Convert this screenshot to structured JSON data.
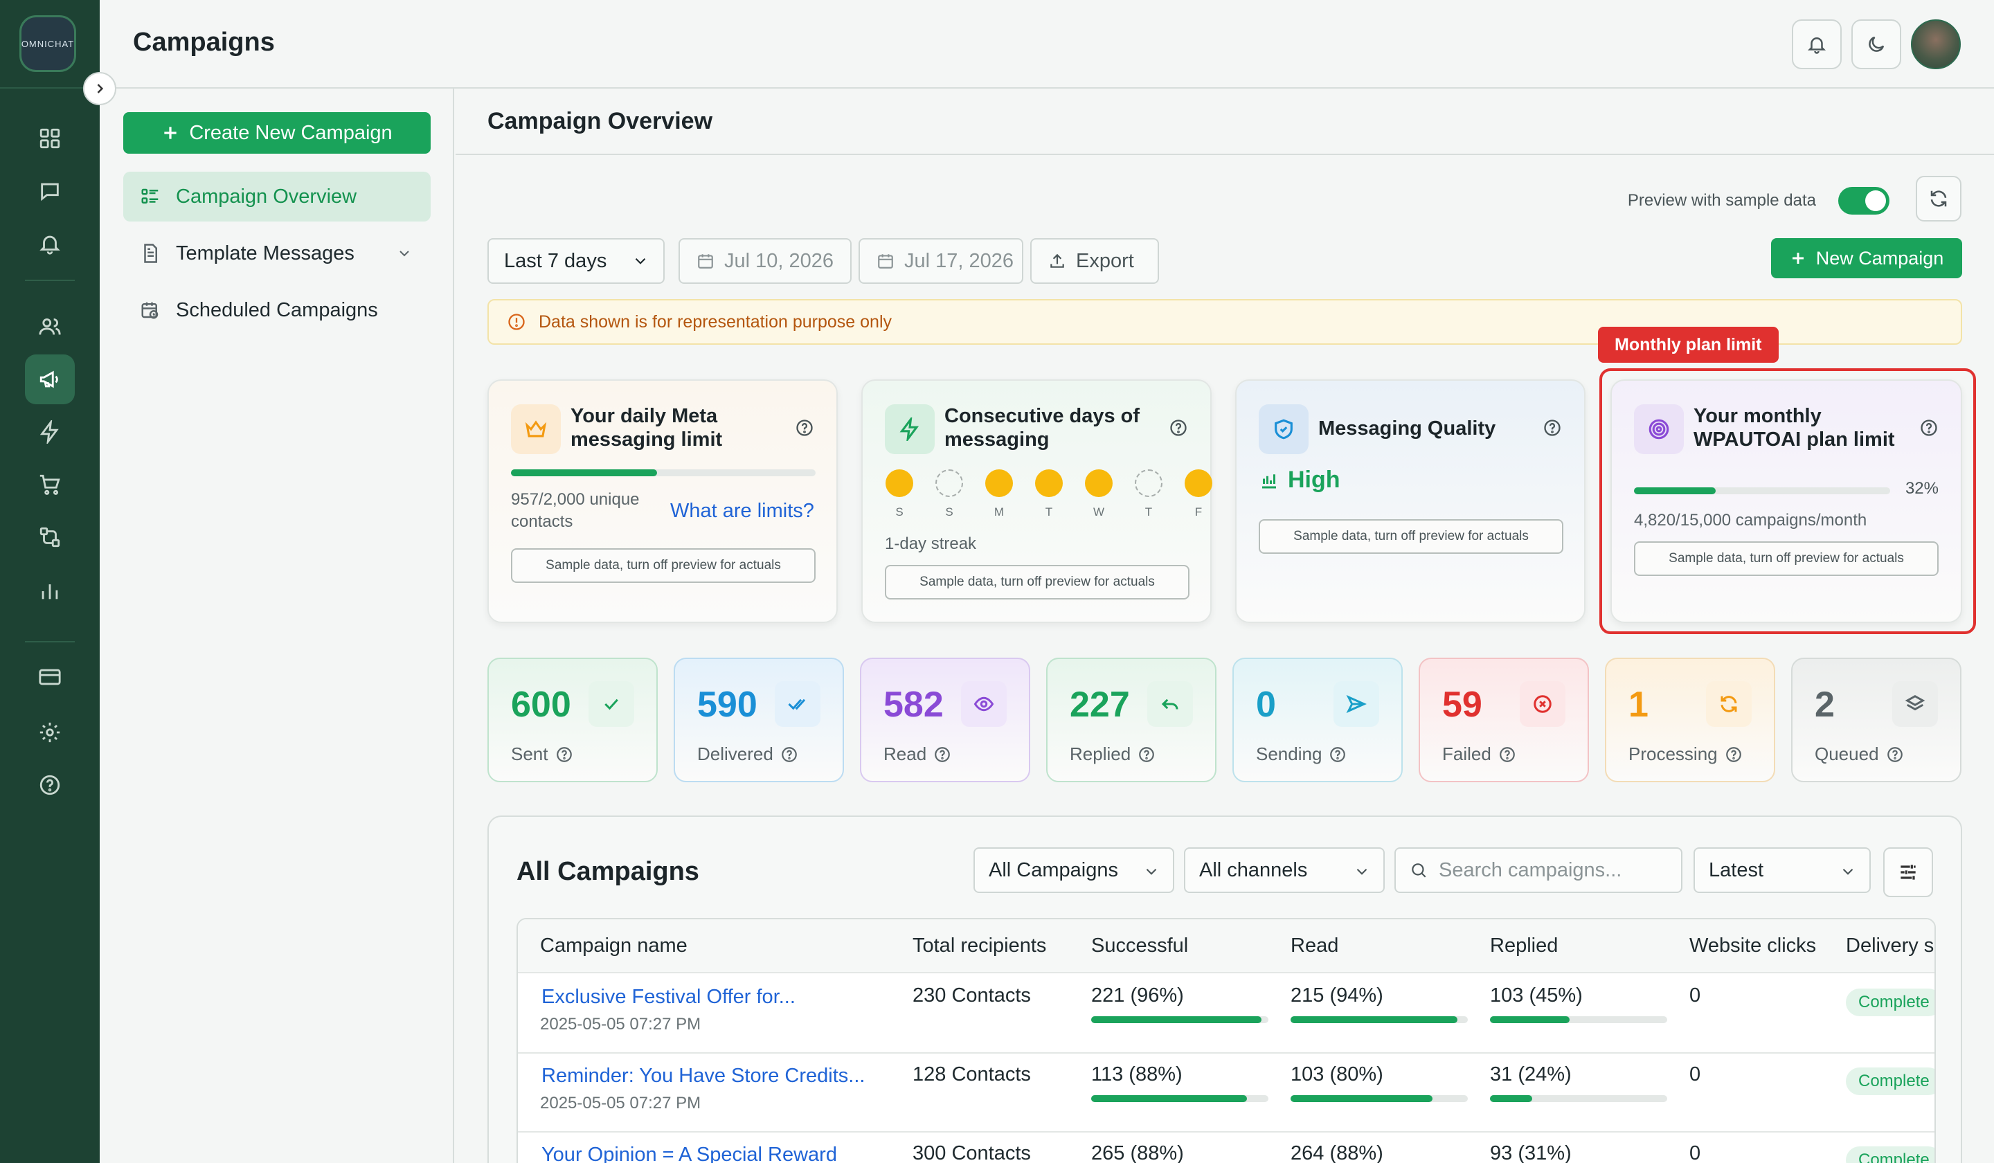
{
  "rail": {
    "logo_text": "OMNICHAT",
    "items": [
      {
        "name": "dashboard-icon"
      },
      {
        "name": "chat-icon"
      },
      {
        "name": "bell-icon"
      },
      {
        "name": "users-icon"
      },
      {
        "name": "megaphone-icon",
        "active": true
      },
      {
        "name": "bolt-icon"
      },
      {
        "name": "cart-icon"
      },
      {
        "name": "flow-icon"
      },
      {
        "name": "bar-chart-icon"
      },
      {
        "name": "card-icon"
      },
      {
        "name": "settings-icon"
      },
      {
        "name": "help-icon"
      }
    ]
  },
  "header": {
    "title": "Campaigns"
  },
  "subnav": {
    "create_label": "Create New Campaign",
    "items": [
      {
        "label": "Campaign Overview",
        "active": true
      },
      {
        "label": "Template Messages"
      },
      {
        "label": "Scheduled Campaigns"
      }
    ]
  },
  "main": {
    "title": "Campaign Overview",
    "preview_label": "Preview with sample data",
    "preview_on": true,
    "range_select": "Last 7 days",
    "date_from": "Jul 10, 2026",
    "date_to": "Jul 17, 2026",
    "export_label": "Export",
    "new_campaign_label": "New Campaign",
    "notice": "Data shown is for representation purpose only"
  },
  "limit_cards": {
    "meta": {
      "title": "Your daily Meta messaging limit",
      "usage": "957/2,000 unique contacts",
      "usage_fraction": 0.4785,
      "link": "What are limits?",
      "chip": "Sample data, turn off preview for actuals"
    },
    "streak": {
      "title": "Consecutive days of messaging",
      "days": [
        {
          "d": "S",
          "on": true
        },
        {
          "d": "S",
          "on": false
        },
        {
          "d": "M",
          "on": true
        },
        {
          "d": "T",
          "on": true
        },
        {
          "d": "W",
          "on": true
        },
        {
          "d": "T",
          "on": false
        },
        {
          "d": "F",
          "on": true
        }
      ],
      "streak_text": "1-day streak",
      "chip": "Sample data, turn off preview for actuals"
    },
    "quality": {
      "title": "Messaging Quality",
      "value": "High",
      "chip": "Sample data, turn off preview for actuals"
    },
    "plan": {
      "badge": "Monthly plan limit",
      "title": "Your monthly WPAUTOAI plan limit",
      "percent": "32%",
      "percent_value": 32,
      "usage": "4,820/15,000 campaigns/month",
      "chip": "Sample data, turn off preview for actuals"
    }
  },
  "stats": [
    {
      "value": "600",
      "label": "Sent",
      "icon": "check-icon",
      "color": "#1aa35b",
      "tint": "#e7f5ec",
      "border": "#bfe3cd"
    },
    {
      "value": "590",
      "label": "Delivered",
      "icon": "double-check-icon",
      "color": "#1a8fd6",
      "tint": "#e4f1fb",
      "border": "#bcdcf2"
    },
    {
      "value": "582",
      "label": "Read",
      "icon": "eye-icon",
      "color": "#8a4ad6",
      "tint": "#efe6fa",
      "border": "#d9c9f0"
    },
    {
      "value": "227",
      "label": "Replied",
      "icon": "reply-icon",
      "color": "#1aa35b",
      "tint": "#e7f5ec",
      "border": "#bfe3cd"
    },
    {
      "value": "0",
      "label": "Sending",
      "icon": "send-icon",
      "color": "#1a9fc8",
      "tint": "#e2f4f8",
      "border": "#bde2ec"
    },
    {
      "value": "59",
      "label": "Failed",
      "icon": "x-circle-icon",
      "color": "#e0312f",
      "tint": "#fce7e8",
      "border": "#f3c3c5"
    },
    {
      "value": "1",
      "label": "Processing",
      "icon": "refresh-icon",
      "color": "#f39a12",
      "tint": "#fdf1de",
      "border": "#f3dcb6"
    },
    {
      "value": "2",
      "label": "Queued",
      "icon": "layers-icon",
      "color": "#5a6468",
      "tint": "#eceeed",
      "border": "#d6dbd9"
    }
  ],
  "campaigns": {
    "title": "All Campaigns",
    "filter_type": "All Campaigns",
    "filter_channel": "All channels",
    "search_placeholder": "Search campaigns...",
    "sort": "Latest",
    "columns": [
      "Campaign name",
      "Total recipients",
      "Successful",
      "Read",
      "Replied",
      "Website clicks",
      "Delivery s"
    ],
    "rows": [
      {
        "name": "Exclusive Festival Offer for...",
        "date": "2025-05-05 07:27 PM",
        "recipients": "230 Contacts",
        "successful": "221 (96%)",
        "successful_pct": 96,
        "read": "215 (94%)",
        "read_pct": 94,
        "replied": "103 (45%)",
        "replied_pct": 45,
        "clicks": "0",
        "status": "Complete"
      },
      {
        "name": "Reminder: You Have Store Credits...",
        "date": "2025-05-05 07:27 PM",
        "recipients": "128 Contacts",
        "successful": "113 (88%)",
        "successful_pct": 88,
        "read": "103 (80%)",
        "read_pct": 80,
        "replied": "31 (24%)",
        "replied_pct": 24,
        "clicks": "0",
        "status": "Complete"
      },
      {
        "name": "Your Opinion = A Special Reward",
        "date": "",
        "recipients": "300 Contacts",
        "successful": "265 (88%)",
        "successful_pct": 88,
        "read": "264 (88%)",
        "read_pct": 88,
        "replied": "93 (31%)",
        "replied_pct": 31,
        "clicks": "0",
        "status": "Complete"
      }
    ]
  }
}
